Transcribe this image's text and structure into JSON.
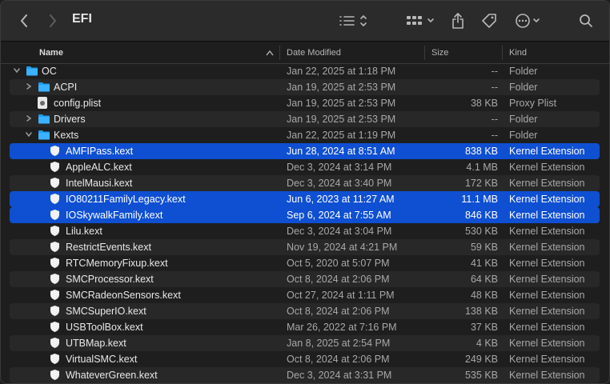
{
  "window": {
    "title": "EFI"
  },
  "toolbar": {
    "back_icon": "chevron-left-icon",
    "forward_icon": "chevron-right-icon",
    "view_icon": "list-view-icon",
    "group_icon": "group-grid-icon",
    "share_icon": "share-icon",
    "tag_icon": "tag-icon",
    "more_icon": "ellipsis-circle-icon",
    "search_icon": "search-icon"
  },
  "columns": {
    "name": "Name",
    "date": "Date Modified",
    "size": "Size",
    "kind": "Kind"
  },
  "colors": {
    "selection": "#0f4fd1",
    "folder": "#1e9cf0"
  },
  "rows": [
    {
      "name": "OC",
      "date": "Jan 22, 2025 at 1:18 PM",
      "size": "--",
      "kind": "Folder",
      "icon": "folder-icon",
      "disclosure": "expanded",
      "selected": false
    },
    {
      "name": "ACPI",
      "date": "Jan 19, 2025 at 2:53 PM",
      "size": "--",
      "kind": "Folder",
      "icon": "folder-icon",
      "disclosure": "collapsed",
      "selected": false
    },
    {
      "name": "config.plist",
      "date": "Jan 19, 2025 at 2:53 PM",
      "size": "38 KB",
      "kind": "Proxy Plist",
      "icon": "plist-file-icon",
      "disclosure": "none",
      "selected": false
    },
    {
      "name": "Drivers",
      "date": "Jan 19, 2025 at 2:53 PM",
      "size": "--",
      "kind": "Folder",
      "icon": "folder-icon",
      "disclosure": "collapsed",
      "selected": false
    },
    {
      "name": "Kexts",
      "date": "Jan 22, 2025 at 1:19 PM",
      "size": "--",
      "kind": "Folder",
      "icon": "folder-icon",
      "disclosure": "expanded",
      "selected": false
    },
    {
      "name": "AMFIPass.kext",
      "date": "Jun 28, 2024 at 8:51 AM",
      "size": "838 KB",
      "kind": "Kernel Extension",
      "icon": "kext-icon",
      "disclosure": "none",
      "selected": true
    },
    {
      "name": "AppleALC.kext",
      "date": "Dec 3, 2024 at 3:14 PM",
      "size": "4.1 MB",
      "kind": "Kernel Extension",
      "icon": "kext-icon",
      "disclosure": "none",
      "selected": false
    },
    {
      "name": "IntelMausi.kext",
      "date": "Dec 3, 2024 at 3:40 PM",
      "size": "172 KB",
      "kind": "Kernel Extension",
      "icon": "kext-icon",
      "disclosure": "none",
      "selected": false
    },
    {
      "name": "IO80211FamilyLegacy.kext",
      "date": "Jun 6, 2023 at 11:27 AM",
      "size": "11.1 MB",
      "kind": "Kernel Extension",
      "icon": "kext-icon",
      "disclosure": "none",
      "selected": true
    },
    {
      "name": "IOSkywalkFamily.kext",
      "date": "Sep 6, 2024 at 7:55 AM",
      "size": "846 KB",
      "kind": "Kernel Extension",
      "icon": "kext-icon",
      "disclosure": "none",
      "selected": true
    },
    {
      "name": "Lilu.kext",
      "date": "Dec 3, 2024 at 3:04 PM",
      "size": "530 KB",
      "kind": "Kernel Extension",
      "icon": "kext-icon",
      "disclosure": "none",
      "selected": false
    },
    {
      "name": "RestrictEvents.kext",
      "date": "Nov 19, 2024 at 4:21 PM",
      "size": "59 KB",
      "kind": "Kernel Extension",
      "icon": "kext-icon",
      "disclosure": "none",
      "selected": false
    },
    {
      "name": "RTCMemoryFixup.kext",
      "date": "Oct 5, 2020 at 5:07 PM",
      "size": "41 KB",
      "kind": "Kernel Extension",
      "icon": "kext-icon",
      "disclosure": "none",
      "selected": false
    },
    {
      "name": "SMCProcessor.kext",
      "date": "Oct 8, 2024 at 2:06 PM",
      "size": "64 KB",
      "kind": "Kernel Extension",
      "icon": "kext-icon",
      "disclosure": "none",
      "selected": false
    },
    {
      "name": "SMCRadeonSensors.kext",
      "date": "Oct 27, 2024 at 1:11 PM",
      "size": "48 KB",
      "kind": "Kernel Extension",
      "icon": "kext-icon",
      "disclosure": "none",
      "selected": false
    },
    {
      "name": "SMCSuperIO.kext",
      "date": "Oct 8, 2024 at 2:06 PM",
      "size": "138 KB",
      "kind": "Kernel Extension",
      "icon": "kext-icon",
      "disclosure": "none",
      "selected": false
    },
    {
      "name": "USBToolBox.kext",
      "date": "Mar 26, 2022 at 7:16 PM",
      "size": "37 KB",
      "kind": "Kernel Extension",
      "icon": "kext-icon",
      "disclosure": "none",
      "selected": false
    },
    {
      "name": "UTBMap.kext",
      "date": "Jan 8, 2025 at 2:54 PM",
      "size": "4 KB",
      "kind": "Kernel Extension",
      "icon": "kext-icon",
      "disclosure": "none",
      "selected": false
    },
    {
      "name": "VirtualSMC.kext",
      "date": "Oct 8, 2024 at 2:06 PM",
      "size": "249 KB",
      "kind": "Kernel Extension",
      "icon": "kext-icon",
      "disclosure": "none",
      "selected": false
    },
    {
      "name": "WhateverGreen.kext",
      "date": "Dec 3, 2024 at 3:31 PM",
      "size": "535 KB",
      "kind": "Kernel Extension",
      "icon": "kext-icon",
      "disclosure": "none",
      "selected": false
    }
  ]
}
